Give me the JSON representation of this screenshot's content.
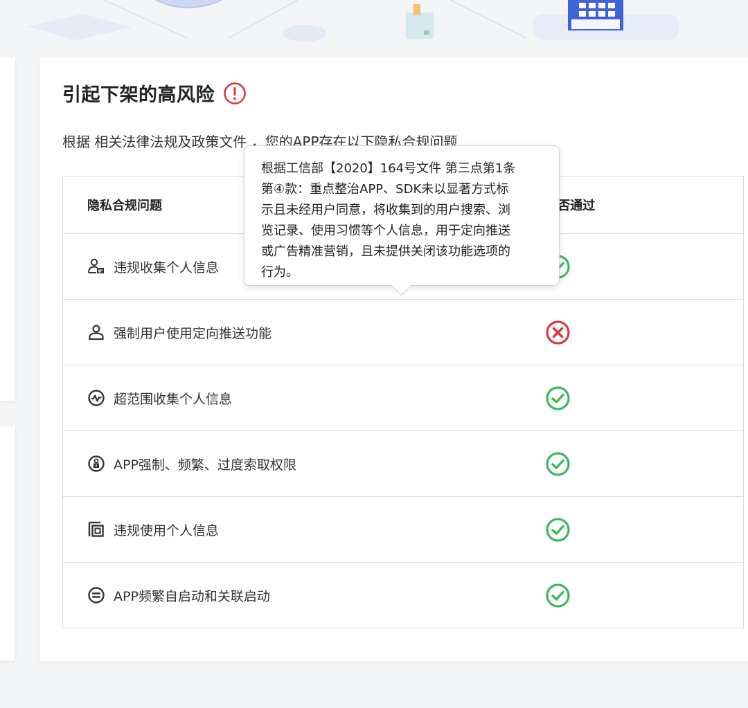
{
  "section": {
    "title": "引起下架的高风险",
    "warn_icon": "exclamation-circle-icon",
    "description": "根据 相关法律法规及政策文件 ，您的APP存在以下隐私合规问题"
  },
  "table": {
    "headers": [
      "隐私合规问题",
      "是否通过"
    ],
    "rows": [
      {
        "icon": "user-id-icon",
        "label": "违规收集个人信息",
        "status": "pass"
      },
      {
        "icon": "user-icon",
        "label": "强制用户使用定向推送功能",
        "status": "fail"
      },
      {
        "icon": "pulse-icon",
        "label": "超范围收集个人信息",
        "status": "pass"
      },
      {
        "icon": "lock-user-icon",
        "label": "APP强制、频繁、过度索取权限",
        "status": "pass"
      },
      {
        "icon": "copy-icon",
        "label": "违规使用个人信息",
        "status": "pass"
      },
      {
        "icon": "equal-circle-icon",
        "label": "APP频繁自启动和关联启动",
        "status": "pass"
      }
    ]
  },
  "tooltip": {
    "lines": [
      "根据工信部【2020】164号文件 第三点第1条",
      "第④款：重点整治APP、SDK未以显著方式标",
      "示且未经用户同意，将收集到的用户搜索、浏",
      "览记录、使用习惯等个人信息，用于定向推送",
      "或广告精准营销，且未提供关闭该功能选项的",
      "行为。"
    ]
  },
  "colors": {
    "pass": "#3cb85c",
    "fail": "#d9363e",
    "warn": "#d9363e"
  }
}
